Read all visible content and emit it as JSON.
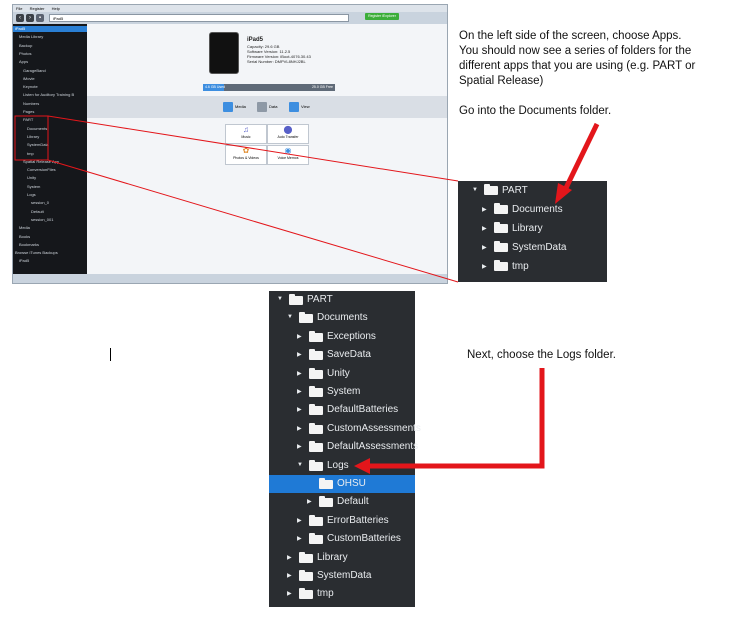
{
  "instructions": {
    "step1_line1": "On the left side of the screen, choose Apps.",
    "step1_line2": "You should now see a series of folders for the",
    "step1_line3": "different apps that you are using (e.g. PART or",
    "step1_line4": "Spatial Release)",
    "step2": "Go into the Documents folder.",
    "step3": "Next, choose the Logs folder."
  },
  "app_screenshot": {
    "menu": [
      "File",
      "Register",
      "Help"
    ],
    "address": "iPad5",
    "register_button": "Register iExplorer",
    "sidebar": [
      {
        "label": "iPad5",
        "selected": true
      },
      {
        "label": "Media Library"
      },
      {
        "label": "Backup"
      },
      {
        "label": "Photos"
      },
      {
        "label": "Apps"
      },
      {
        "label": "GarageBand"
      },
      {
        "label": "iMovie"
      },
      {
        "label": "Keynote"
      },
      {
        "label": "Listen for Auditory Training B"
      },
      {
        "label": "Numbers"
      },
      {
        "label": "Pages"
      },
      {
        "label": "PART"
      },
      {
        "label": "Documents"
      },
      {
        "label": "Library"
      },
      {
        "label": "SystemData"
      },
      {
        "label": "tmp"
      },
      {
        "label": "Spatial Release App"
      },
      {
        "label": "ConversionFiles"
      },
      {
        "label": "Unity"
      },
      {
        "label": "System"
      },
      {
        "label": "Logs"
      },
      {
        "label": "session_0"
      },
      {
        "label": "Default"
      },
      {
        "label": "session_001"
      },
      {
        "label": "Media"
      },
      {
        "label": "Books"
      },
      {
        "label": "Bookmarks"
      },
      {
        "label": "Browse iTunes Backups"
      },
      {
        "label": "iPad5"
      }
    ],
    "device": {
      "name": "iPad5",
      "capacity": "Capacity: 29.6 GB",
      "software": "Software Version: 11.2.5",
      "firmware": "Firmware Version: iBoot-4076.30.43",
      "serial": "Serial Number: DMPVL8NHJ2BL"
    },
    "capacity_bar": {
      "used_label": "4.6 GB Used",
      "free_label": "25.0 GB Free",
      "used_fraction": 0.16
    },
    "tabs": [
      "Media",
      "Data",
      "View"
    ],
    "tiles": [
      "Music",
      "Auto Transfer",
      "Photos & Videos",
      "Voice Memos"
    ]
  },
  "tree_small": [
    {
      "label": "PART",
      "expanded": true,
      "level": 0
    },
    {
      "label": "Documents",
      "level": 1
    },
    {
      "label": "Library",
      "level": 1
    },
    {
      "label": "SystemData",
      "level": 1
    },
    {
      "label": "tmp",
      "level": 1
    }
  ],
  "tree_large": [
    {
      "label": "PART",
      "expanded": true,
      "level": 0
    },
    {
      "label": "Documents",
      "expanded": true,
      "level": 1
    },
    {
      "label": "Exceptions",
      "level": 2
    },
    {
      "label": "SaveData",
      "level": 2
    },
    {
      "label": "Unity",
      "level": 2
    },
    {
      "label": "System",
      "level": 2
    },
    {
      "label": "DefaultBatteries",
      "level": 2
    },
    {
      "label": "CustomAssessments",
      "level": 2
    },
    {
      "label": "DefaultAssessments",
      "level": 2
    },
    {
      "label": "Logs",
      "expanded": true,
      "level": 2
    },
    {
      "label": "OHSU",
      "level": 3,
      "selected": true,
      "noarrow": true
    },
    {
      "label": "Default",
      "level": 3
    },
    {
      "label": "ErrorBatteries",
      "level": 2
    },
    {
      "label": "CustomBatteries",
      "level": 2
    },
    {
      "label": "Library",
      "level": 1
    },
    {
      "label": "SystemData",
      "level": 1
    },
    {
      "label": "tmp",
      "level": 1
    }
  ],
  "colors": {
    "pointer": "#e3161b",
    "tree_bg": "#2a2d31",
    "selection": "#1f7ad6"
  }
}
